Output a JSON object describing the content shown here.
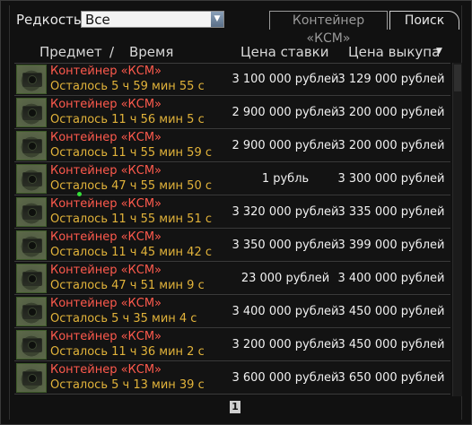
{
  "filter": {
    "rarity_label": "Редкость",
    "rarity_value": "Все",
    "tabs": [
      {
        "label": "Контейнер «КСМ»",
        "active": false
      },
      {
        "label": "Поиск",
        "active": true
      }
    ]
  },
  "columns": {
    "item": "Предмет",
    "separator": "/",
    "time": "Время",
    "bid": "Цена ставки",
    "buyout": "Цена выкупа"
  },
  "rows": [
    {
      "name": "Контейнер «КСМ»",
      "time": "Осталось 5 ч 59 мин 55 с",
      "bid": "3 100 000 рублей",
      "buyout": "3 129 000 рублей"
    },
    {
      "name": "Контейнер «КСМ»",
      "time": "Осталось 11 ч 56 мин 5 с",
      "bid": "2 900 000 рублей",
      "buyout": "3 200 000 рублей"
    },
    {
      "name": "Контейнер «КСМ»",
      "time": "Осталось 11 ч 55 мин 59 с",
      "bid": "2 900 000 рублей",
      "buyout": "3 200 000 рублей"
    },
    {
      "name": "Контейнер «КСМ»",
      "time": "Осталось 47 ч 55 мин 50 с",
      "bid": "1 рубль",
      "buyout": "3 300 000 рублей"
    },
    {
      "name": "Контейнер «КСМ»",
      "time": "Осталось 11 ч 55 мин 51 с",
      "bid": "3 320 000 рублей",
      "buyout": "3 335 000 рублей"
    },
    {
      "name": "Контейнер «КСМ»",
      "time": "Осталось 11 ч 45 мин 42 с",
      "bid": "3 350 000 рублей",
      "buyout": "3 399 000 рублей"
    },
    {
      "name": "Контейнер «КСМ»",
      "time": "Осталось 47 ч 51 мин 9 с",
      "bid": "23 000 рублей",
      "buyout": "3 400 000 рублей"
    },
    {
      "name": "Контейнер «КСМ»",
      "time": "Осталось 5 ч 35 мин 4 с",
      "bid": "3 400 000 рублей",
      "buyout": "3 450 000 рублей"
    },
    {
      "name": "Контейнер «КСМ»",
      "time": "Осталось 11 ч 36 мин 2 с",
      "bid": "3 200 000 рублей",
      "buyout": "3 450 000 рублей"
    },
    {
      "name": "Контейнер «КСМ»",
      "time": "Осталось 5 ч 13 мин 39 с",
      "bid": "3 600 000 рублей",
      "buyout": "3 650 000 рублей"
    }
  ],
  "pagination": {
    "current_page": "1"
  },
  "colors": {
    "item_name": "#ff5a4d",
    "time_left": "#e2b33a",
    "price": "#f0f0f0"
  }
}
